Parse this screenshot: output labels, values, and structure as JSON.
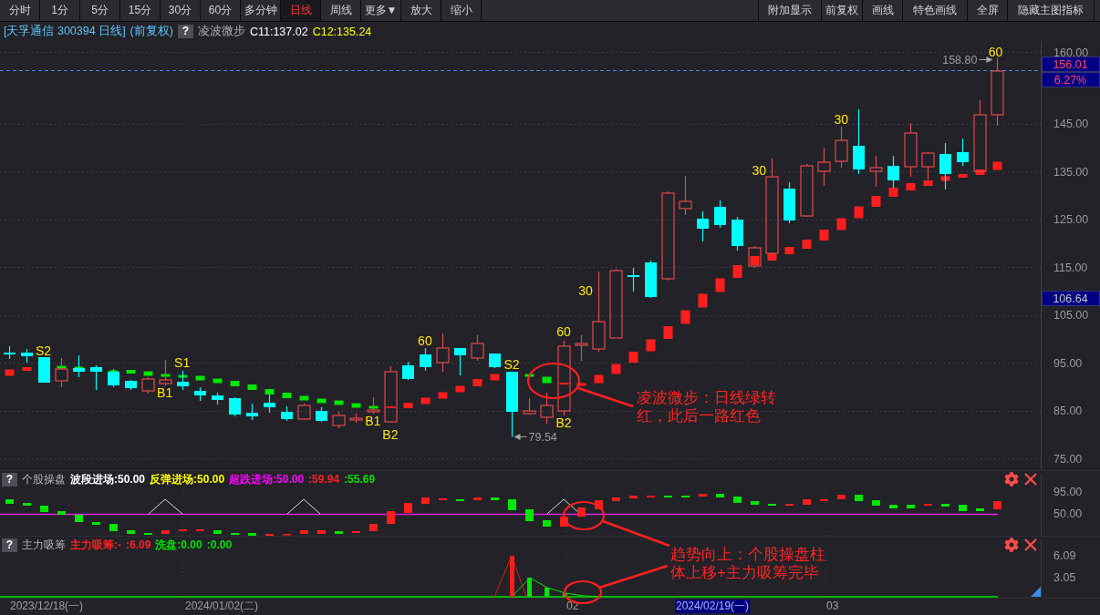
{
  "toolbar": {
    "periods": [
      {
        "label": "分时",
        "selected": false
      },
      {
        "label": "1分",
        "selected": false
      },
      {
        "label": "5分",
        "selected": false
      },
      {
        "label": "15分",
        "selected": false
      },
      {
        "label": "30分",
        "selected": false
      },
      {
        "label": "60分",
        "selected": false
      },
      {
        "label": "多分钟",
        "selected": false
      },
      {
        "label": "日线",
        "selected": true
      },
      {
        "label": "周线",
        "selected": false
      },
      {
        "label": "更多▼",
        "selected": false
      },
      {
        "label": "放大",
        "selected": false
      },
      {
        "label": "缩小",
        "selected": false
      }
    ],
    "actions": [
      "附加显示",
      "前复权",
      "画线",
      "特色画线",
      "全屏",
      "隐藏主图指标"
    ]
  },
  "title_bar": {
    "security": "[天孚通信 300394 日线]",
    "adjustment": "(前复权)",
    "help": "?",
    "indicator": "凌波微步",
    "values": [
      {
        "text": "C11:137.02",
        "color": "#ffffff"
      },
      {
        "text": "C12:135.24",
        "color": "#ffff00"
      }
    ]
  },
  "main_chart": {
    "chart_data": {
      "type": "candlestick",
      "categories": [
        null,
        null,
        null,
        null,
        null,
        null,
        null,
        null,
        null,
        null,
        null,
        null,
        null,
        null,
        null,
        null,
        null,
        null,
        null,
        null,
        null,
        null,
        null,
        null,
        null,
        null,
        null,
        null,
        null,
        null,
        null,
        null,
        null,
        null,
        null,
        null,
        null,
        null,
        null,
        null,
        null,
        null,
        null,
        null,
        null,
        null,
        null,
        null,
        null,
        null,
        null,
        null,
        null,
        null,
        null,
        null,
        null,
        null,
        null,
        null
      ],
      "ohlc": [
        [
          97.14,
          98.48,
          95.81,
          96.76
        ],
        [
          97.14,
          97.9,
          95.05,
          96.38
        ],
        [
          96.19,
          96.19,
          90.86,
          90.86
        ],
        [
          91.24,
          96.0,
          89.9,
          93.71
        ],
        [
          93.9,
          96.57,
          92.0,
          93.14
        ],
        [
          94.1,
          94.48,
          89.33,
          93.14
        ],
        [
          93.14,
          93.71,
          89.9,
          90.29
        ],
        [
          91.24,
          91.43,
          89.33,
          89.71
        ],
        [
          89.14,
          92.0,
          88.57,
          91.62
        ],
        [
          90.67,
          95.62,
          90.29,
          91.43
        ],
        [
          91.05,
          93.33,
          89.33,
          90.1
        ],
        [
          89.14,
          89.9,
          87.05,
          88.19
        ],
        [
          88.19,
          88.76,
          86.29,
          87.24
        ],
        [
          87.62,
          87.81,
          83.81,
          84.19
        ],
        [
          84.57,
          86.48,
          83.05,
          83.81
        ],
        [
          86.67,
          88.38,
          84.57,
          85.71
        ],
        [
          84.76,
          85.9,
          82.86,
          83.24
        ],
        [
          83.24,
          86.48,
          83.05,
          86.1
        ],
        [
          84.95,
          85.71,
          82.67,
          82.86
        ],
        [
          81.9,
          84.76,
          81.33,
          84.0
        ],
        [
          83.05,
          84.38,
          82.48,
          83.43
        ],
        [
          84.76,
          87.81,
          84.38,
          85.14
        ],
        [
          82.67,
          94.29,
          82.67,
          93.14
        ],
        [
          94.48,
          95.24,
          91.43,
          91.62
        ],
        [
          96.76,
          98.1,
          93.33,
          94.1
        ],
        [
          95.05,
          101.14,
          93.14,
          98.1
        ],
        [
          98.1,
          98.1,
          92.38,
          96.57
        ],
        [
          96.0,
          100.76,
          95.43,
          99.05
        ],
        [
          96.95,
          96.95,
          93.9,
          94.1
        ],
        [
          93.14,
          93.14,
          79.54,
          84.76
        ],
        [
          84.38,
          87.62,
          84.19,
          84.95
        ],
        [
          83.62,
          88.76,
          82.29,
          86.1
        ],
        [
          84.95,
          99.62,
          84.0,
          98.48
        ],
        [
          98.67,
          100.76,
          95.43,
          99.05
        ],
        [
          97.9,
          114.1,
          97.33,
          103.62
        ],
        [
          100.19,
          114.67,
          100.19,
          114.29
        ],
        [
          113.33,
          114.86,
          109.9,
          112.95
        ],
        [
          116.0,
          116.38,
          108.57,
          108.76
        ],
        [
          112.57,
          130.86,
          112.19,
          130.48
        ],
        [
          127.24,
          134.1,
          125.9,
          128.76
        ],
        [
          125.14,
          126.67,
          120.38,
          123.05
        ],
        [
          127.62,
          128.95,
          123.24,
          123.81
        ],
        [
          124.95,
          125.52,
          118.48,
          119.43
        ],
        [
          115.24,
          119.43,
          114.86,
          119.05
        ],
        [
          117.9,
          137.71,
          117.52,
          133.9
        ],
        [
          131.43,
          132.76,
          124.19,
          124.76
        ],
        [
          125.71,
          136.57,
          125.52,
          136.19
        ],
        [
          135.05,
          140.0,
          132.0,
          136.95
        ],
        [
          137.14,
          144.38,
          135.81,
          141.52
        ],
        [
          140.38,
          148.0,
          134.48,
          135.43
        ],
        [
          135.05,
          138.29,
          131.81,
          135.81
        ],
        [
          136.19,
          138.29,
          131.62,
          133.14
        ],
        [
          136.0,
          145.14,
          133.9,
          143.05
        ],
        [
          136.0,
          139.05,
          133.33,
          138.86
        ],
        [
          138.67,
          140.95,
          131.24,
          134.48
        ],
        [
          139.05,
          141.9,
          136.19,
          136.95
        ],
        [
          135.05,
          149.9,
          135.05,
          146.86
        ],
        [
          146.86,
          158.8,
          144.57,
          156.01
        ],
        null,
        null
      ],
      "ylim": [
        72.57,
        162.29
      ],
      "yticks": [
        {
          "value": 160,
          "label": "160.00"
        },
        {
          "value": 145,
          "label": "145.00"
        },
        {
          "value": 135,
          "label": "135.00"
        },
        {
          "value": 125,
          "label": "125.00"
        },
        {
          "value": 115,
          "label": "115.00"
        },
        {
          "value": 105,
          "label": "105.00"
        },
        {
          "value": 95,
          "label": "95.00"
        },
        {
          "value": 85,
          "label": "85.00"
        },
        {
          "value": 75,
          "label": "75.00"
        }
      ],
      "grid": true,
      "ref_lines": [
        {
          "axis": "y",
          "value": 156.01
        }
      ]
    },
    "last_price": "156.01",
    "change": "6.27%",
    "cursor_price": "106.64",
    "high_label": "158.80",
    "low_label": "79.54",
    "signals": [
      "S2",
      "B1",
      "S1",
      "B1",
      "B2",
      "60",
      "S2",
      "60",
      "B2",
      "30",
      "30",
      "30",
      "60"
    ]
  },
  "annotations": [
    "凌波微步：日线绿转红，此后一路红色",
    "趋势向上：个股操盘柱体上移+主力吸筹完毕"
  ],
  "panels": [
    {
      "kind": "bars",
      "help": "?",
      "title": "个股操盘",
      "legend": [
        {
          "text": "波段进场:50.00",
          "color": "#ffffff"
        },
        {
          "text": "反弹进场:50.00",
          "color": "#ffff00"
        },
        {
          "text": "超跌进场:50.00",
          "color": "#ff00ff"
        },
        {
          "text": ":59.94",
          "color": "#ff2020"
        },
        {
          "text": ":55.69",
          "color": "#00e000"
        }
      ],
      "axis": [
        "95.00",
        "50.00"
      ]
    },
    {
      "kind": "spikes",
      "help": "?",
      "title": "主力吸筹",
      "legend": [
        {
          "text": "主力吸筹:-",
          "color": "#ff2020"
        },
        {
          "text": ":6.09",
          "color": "#ff2020"
        },
        {
          "text": "洗盘:0.00",
          "color": "#00e000"
        },
        {
          "text": ":0.00",
          "color": "#00e000"
        }
      ],
      "axis": [
        "6.09",
        "3.05"
      ]
    }
  ],
  "date_axis": [
    {
      "label": "2023/12/18(一)",
      "selected": false
    },
    {
      "label": "2024/01/02(二)",
      "selected": false
    },
    {
      "label": "02",
      "selected": false
    },
    {
      "label": "2024/02/19(一)",
      "selected": true
    },
    {
      "label": "03",
      "selected": false
    }
  ]
}
